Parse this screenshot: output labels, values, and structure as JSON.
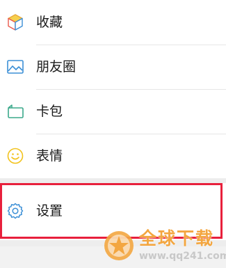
{
  "menu": {
    "items": [
      {
        "label": "收藏",
        "icon": "favorites-cube-icon"
      },
      {
        "label": "朋友圈",
        "icon": "moments-image-icon"
      },
      {
        "label": "卡包",
        "icon": "card-wallet-icon"
      },
      {
        "label": "表情",
        "icon": "sticker-smile-icon"
      },
      {
        "label": "设置",
        "icon": "gear-icon"
      }
    ]
  },
  "highlight": {
    "target": "设置",
    "color": "#e8203c"
  },
  "watermark": {
    "title": "全球下载",
    "url": "www.qq241.com",
    "color": "#f3a640"
  },
  "colors": {
    "background": "#ededed",
    "icon_blue": "#3b8fd6",
    "icon_green": "#3aa88a",
    "icon_yellow": "#f2c21b",
    "icon_red": "#ea5a4d"
  }
}
